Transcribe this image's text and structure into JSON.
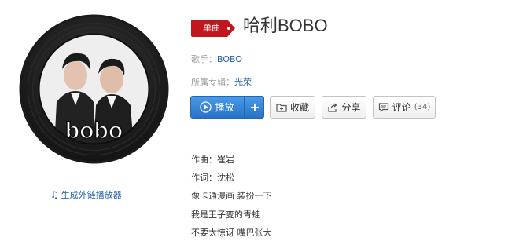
{
  "album_art": {
    "logo_text": "bobo"
  },
  "external_player_link": {
    "icon": "music-note-icon",
    "label": "生成外链播放器"
  },
  "song": {
    "tag_label": "单曲",
    "title": "哈利BOBO",
    "singer_label": "歌手：",
    "singer": "BOBO",
    "album_label": "所属专辑：",
    "album": "光荣"
  },
  "actions": {
    "play_label": "播放",
    "add_label": "+",
    "collect_label": "收藏",
    "share_label": "分享",
    "comment_label": "评论",
    "comment_count": "(34)"
  },
  "lyrics": [
    "作曲：崔岩",
    "作词：沈松",
    "像卡通漫画 装扮一下",
    "我是王子变的青蛙",
    "不要太惊讶 嘴巴张大"
  ],
  "colors": {
    "accent": "#c3151d",
    "link": "#1f5ea8",
    "play_button": "#2a72c8"
  }
}
